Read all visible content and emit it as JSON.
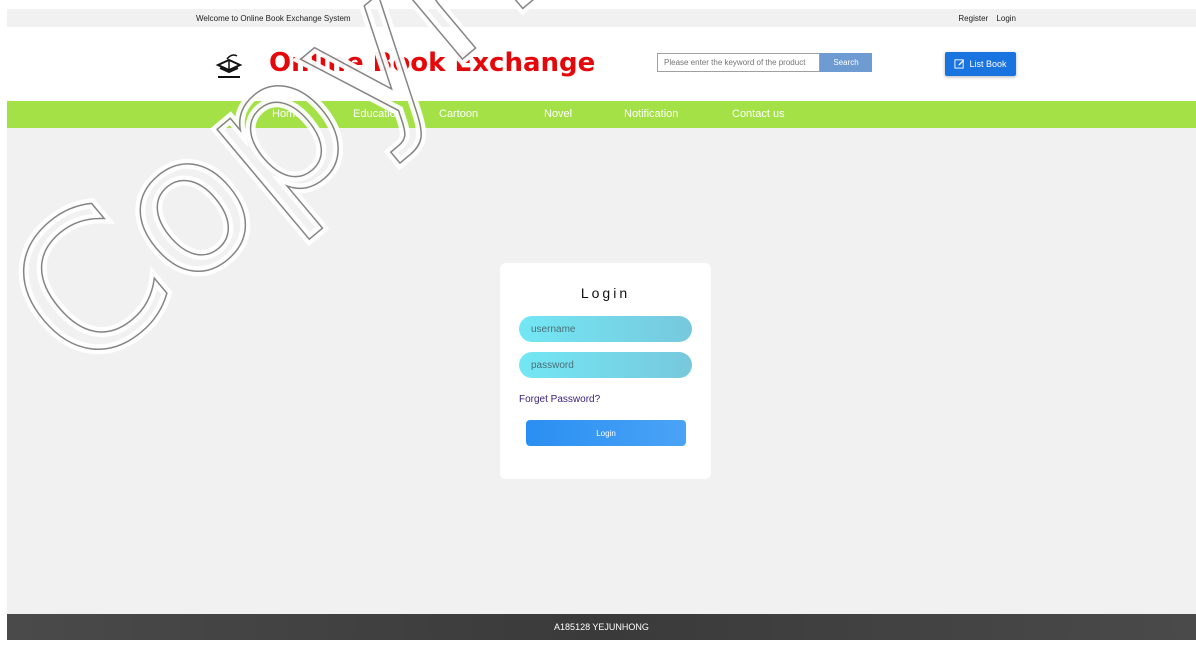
{
  "topbar": {
    "welcome": "Welcome to Online Book Exchange System",
    "register": "Register",
    "login": "Login"
  },
  "header": {
    "title": "Online Book Exchange",
    "search_placeholder": "Please enter the keyword of the product",
    "search_button": "Search",
    "list_book": "List Book"
  },
  "nav": {
    "items": [
      "Home",
      "Education",
      "Cartoon",
      "Novel",
      "Notification",
      "Contact us"
    ]
  },
  "login_form": {
    "title": "Login",
    "username_placeholder": "username",
    "password_placeholder": "password",
    "forget": "Forget Password?",
    "submit": "Login"
  },
  "footer": {
    "text": "A185128 YEJUNHONG"
  },
  "watermark": {
    "text": "Copyright UKM"
  },
  "colors": {
    "title_red": "#e4080b",
    "nav_green": "#a3e147",
    "primary_blue": "#1a74df",
    "field_cyan": "#73e7f4"
  }
}
